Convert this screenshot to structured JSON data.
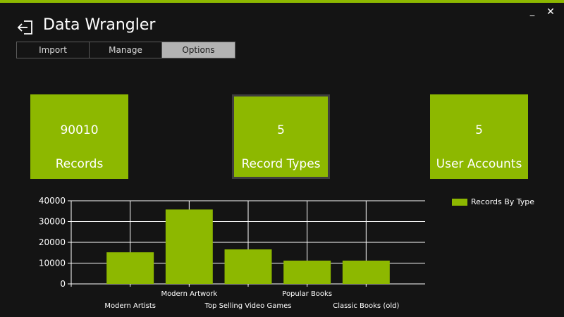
{
  "window": {
    "title": "Data Wrangler",
    "minimize_glyph": "_",
    "close_glyph": "✕",
    "back_icon": "back-arrow-icon",
    "accent_color": "#8db800"
  },
  "tabs": [
    {
      "label": "Import",
      "active": false
    },
    {
      "label": "Manage",
      "active": false
    },
    {
      "label": "Options",
      "active": true
    }
  ],
  "tiles": [
    {
      "value": "90010",
      "label": "Records"
    },
    {
      "value": "5",
      "label": "Record Types"
    },
    {
      "value": "5",
      "label": "User Accounts"
    }
  ],
  "chart_data": {
    "type": "bar",
    "categories": [
      "Modern Artists",
      "Modern Artwork",
      "Top Selling Video Games",
      "Popular Books",
      "Classic Books (old)"
    ],
    "series": [
      {
        "name": "Records By Type",
        "values": [
          15200,
          35800,
          16600,
          11200,
          11200
        ]
      }
    ],
    "yticks": [
      "0",
      "10000",
      "20000",
      "30000",
      "40000"
    ],
    "ylim": [
      0,
      40000
    ],
    "grid": true,
    "legend_position": "right",
    "bar_color": "#8db800"
  }
}
